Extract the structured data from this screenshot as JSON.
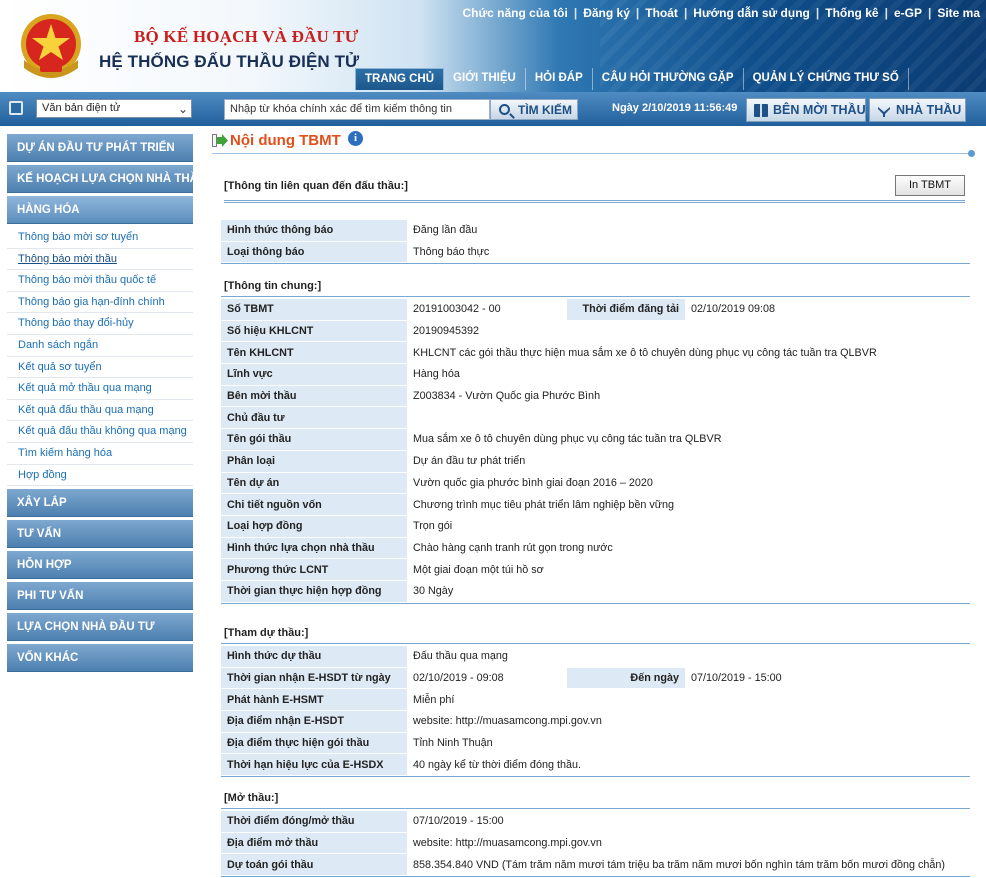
{
  "header": {
    "ministry": "BỘ KẾ HOẠCH VÀ ĐẦU TƯ",
    "system": "HỆ THỐNG ĐẤU THẦU ĐIỆN TỬ",
    "top_links": [
      "Chức năng của tôi",
      "Đăng ký",
      "Thoát",
      "Hướng dẫn sử dụng",
      "Thống kê",
      "e-GP",
      "Site ma"
    ],
    "nav_tabs": [
      "TRANG CHỦ",
      "GIỚI THIỆU",
      "HỎI ĐÁP",
      "CÂU HỎI THƯỜNG GẶP",
      "QUẢN LÝ CHỨNG THƯ SỐ"
    ],
    "active_tab": "TRANG CHỦ"
  },
  "search": {
    "doc_select": "Văn bản điện tử",
    "placeholder": "Nhập từ khóa chính xác để tìm kiếm thông tin",
    "button": "TÌM KIẾM",
    "date": "Ngày 2/10/2019 11:56:49",
    "btn_benmoi": "BÊN MỜI THẦU",
    "btn_nhathau": "NHÀ THẦU"
  },
  "sidebar": {
    "top_groups": [
      "DỰ ÁN ĐẦU TƯ PHÁT TRIỂN",
      "KẾ HOẠCH LỰA CHỌN NHÀ THẦU",
      "HÀNG HÓA"
    ],
    "sub_items": [
      "Thông báo mời sơ tuyển",
      "Thông báo mời thầu",
      "Thông báo mời thầu quốc tế",
      "Thông báo gia hạn-đính chính",
      "Thông báo thay đổi-hủy",
      "Danh sách ngắn",
      "Kết quả sơ tuyển",
      "Kết quả mở thầu qua mạng",
      "Kết quả đấu thầu qua mạng",
      "Kết quả đấu thầu không qua mạng",
      "Tìm kiếm hàng hóa",
      "Hợp đồng"
    ],
    "active_sub": "Thông báo mời thầu",
    "bottom_groups": [
      "XÂY LẮP",
      "TƯ VẤN",
      "HỖN HỢP",
      "PHI TƯ VẤN",
      "LỰA CHỌN NHÀ ĐẦU TƯ",
      "VỐN KHÁC"
    ]
  },
  "content": {
    "title": "Nội dung TBMT",
    "sec_related": "[Thông tin liên quan đến đấu thầu:]",
    "print_button": "In TBMT",
    "notice": {
      "hinh_thuc_tb_label": "Hình thức thông báo",
      "hinh_thuc_tb": "Đăng lần đầu",
      "loai_tb_label": "Loại thông báo",
      "loai_tb": "Thông báo thực"
    },
    "sec_general": "[Thông tin chung:]",
    "general": {
      "so_tbmt_label": "Số TBMT",
      "so_tbmt": "20191003042   -   00",
      "thoi_diem_dang_tai_label": "Thời điểm đăng tải",
      "thoi_diem_dang_tai": "02/10/2019 09:08",
      "rows": [
        {
          "label": "Số hiệu KHLCNT",
          "value": "20190945392"
        },
        {
          "label": "Tên KHLCNT",
          "value": "KHLCNT các gói thầu thực hiện mua sắm xe ô tô chuyên dùng phục vụ công tác tuần tra QLBVR"
        },
        {
          "label": "Lĩnh vực",
          "value": "Hàng hóa"
        },
        {
          "label": "Bên mời thầu",
          "value": "Z003834 - Vườn Quốc gia Phước Bình"
        },
        {
          "label": "Chủ đầu tư",
          "value": ""
        },
        {
          "label": "Tên gói thầu",
          "value": "Mua sắm xe ô tô chuyên dùng phục vụ công tác tuần tra QLBVR"
        },
        {
          "label": "Phân loại",
          "value": "Dự án đầu tư phát triển"
        },
        {
          "label": "Tên dự án",
          "value": "Vườn quốc gia phước bình giai đoạn 2016 – 2020"
        },
        {
          "label": "Chi tiết nguồn vốn",
          "value": "Chương trình mục tiêu phát triển lâm nghiệp bền vững"
        },
        {
          "label": "Loại hợp đồng",
          "value": "Trọn gói"
        },
        {
          "label": "Hình thức lựa chọn nhà thầu",
          "value": "Chào hàng cạnh tranh rút gọn trong nước"
        },
        {
          "label": "Phương thức LCNT",
          "value": "Một giai đoạn một túi hồ sơ"
        },
        {
          "label": "Thời gian thực hiện hợp đồng",
          "value": "30 Ngày"
        }
      ]
    },
    "sec_participate": "[Tham dự thầu:]",
    "participate": {
      "hinh_thuc_du_thau_label": "Hình thức dự thầu",
      "hinh_thuc_du_thau": "Đấu thầu qua mạng",
      "thoi_gian_nhan_label": "Thời gian nhận E-HSDT từ ngày",
      "thoi_gian_nhan": "02/10/2019 - 09:08",
      "den_ngay_label": "Đến ngày",
      "den_ngay": "07/10/2019 - 15:00",
      "rows": [
        {
          "label": "Phát hành E-HSMT",
          "value": "Miễn phí"
        },
        {
          "label": "Địa điểm nhận E-HSDT",
          "value": "website: http://muasamcong.mpi.gov.vn"
        },
        {
          "label": "Địa điểm thực hiện gói thầu",
          "value": "Tỉnh Ninh Thuận"
        },
        {
          "label": "Thời hạn hiệu lực của E-HSDX",
          "value": "40 ngày kể từ thời điểm đóng thầu."
        }
      ]
    },
    "sec_opening": "[Mở thầu:]",
    "opening": {
      "rows": [
        {
          "label": "Thời điểm đóng/mở thầu",
          "value": "07/10/2019 - 15:00"
        },
        {
          "label": "Địa điểm mở thầu",
          "value": "website: http://muasamcong.mpi.gov.vn"
        },
        {
          "label": "Dự toán gói thầu",
          "value": "858.354.840 VND (Tám trăm năm mươi tám triệu ba trăm năm mươi bốn nghìn tám trăm bốn mươi đồng chẵn)"
        }
      ]
    }
  }
}
